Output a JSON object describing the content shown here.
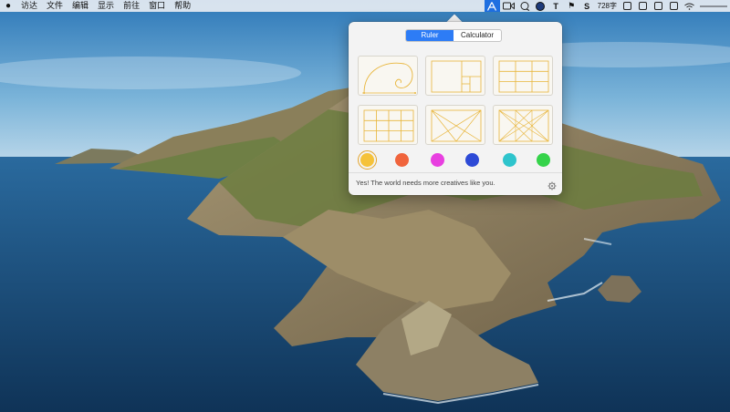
{
  "menubar": {
    "apple": "",
    "items": [
      "访达",
      "文件",
      "编辑",
      "显示",
      "前往",
      "窗口",
      "帮助"
    ],
    "status": {
      "word_count": "728字"
    }
  },
  "popover": {
    "tabs": [
      "Ruler",
      "Calculator"
    ],
    "selected_tab": "Ruler",
    "grids": [
      "golden-spiral",
      "golden-rectangle",
      "rule-of-thirds",
      "grid-4x3",
      "diagonal-x",
      "diagonal-lines"
    ],
    "colors": [
      "#f5c23a",
      "#f0643c",
      "#e83fe0",
      "#2d4ad6",
      "#2ec4cc",
      "#35d34a"
    ],
    "selected_color": "#f5c23a",
    "message": "Yes! The world needs more creatives like you."
  },
  "colors": {
    "accent": "#2d7cf6",
    "guide_line": "#e8b53a"
  }
}
